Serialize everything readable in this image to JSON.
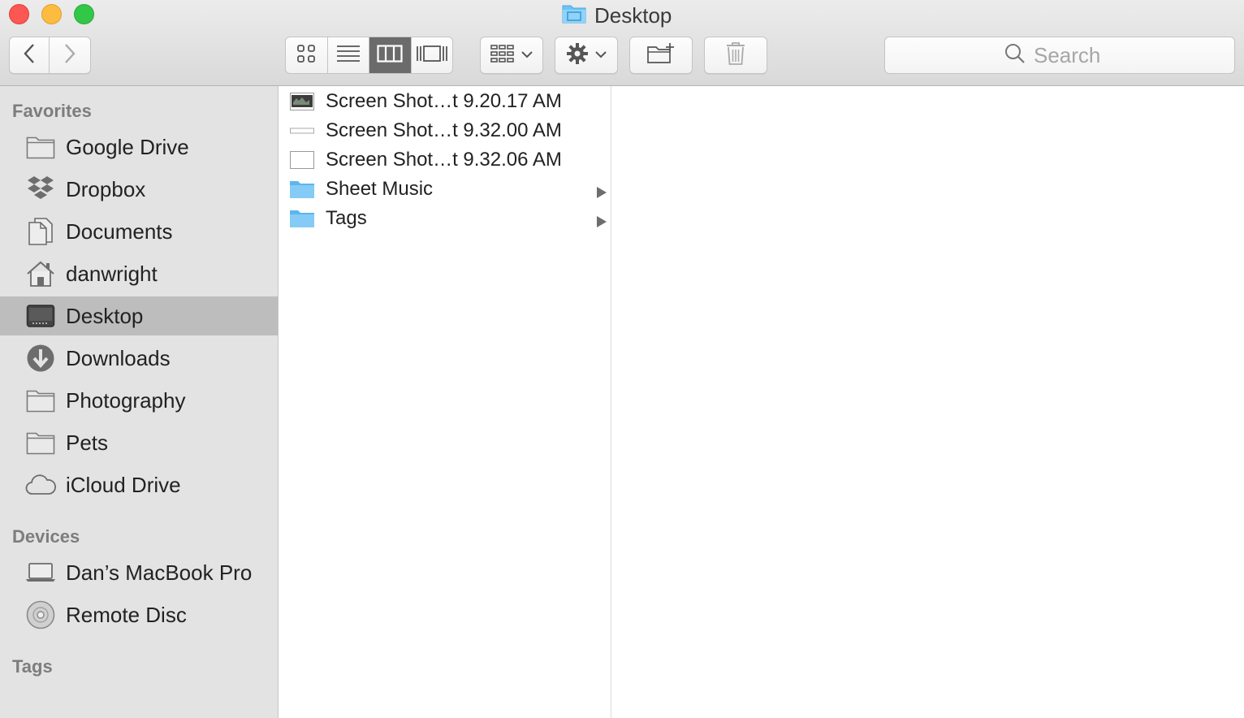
{
  "window": {
    "title": "Desktop"
  },
  "toolbar": {
    "search_placeholder": "Search",
    "view_mode_selected": "column"
  },
  "sidebar": {
    "favorites_title": "Favorites",
    "favorites": [
      {
        "label": "Google Drive",
        "icon": "folder-icon"
      },
      {
        "label": "Dropbox",
        "icon": "dropbox-icon"
      },
      {
        "label": "Documents",
        "icon": "documents-icon"
      },
      {
        "label": "danwright",
        "icon": "home-icon"
      },
      {
        "label": "Desktop",
        "icon": "desktop-icon",
        "selected": true
      },
      {
        "label": "Downloads",
        "icon": "downloads-icon"
      },
      {
        "label": "Photography",
        "icon": "folder-icon"
      },
      {
        "label": "Pets",
        "icon": "folder-icon"
      },
      {
        "label": "iCloud Drive",
        "icon": "cloud-icon"
      }
    ],
    "devices_title": "Devices",
    "devices": [
      {
        "label": "Dan’s MacBook Pro",
        "icon": "laptop-icon"
      },
      {
        "label": "Remote Disc",
        "icon": "disc-icon"
      }
    ],
    "tags_title": "Tags"
  },
  "column1": {
    "items": [
      {
        "name": "Screen Shot…t 9.20.17 AM",
        "kind": "image-thumbnail"
      },
      {
        "name": "Screen Shot…t 9.32.00 AM",
        "kind": "image-thumbnail"
      },
      {
        "name": "Screen Shot…t 9.32.06 AM",
        "kind": "image-thumbnail"
      },
      {
        "name": "Sheet Music",
        "kind": "folder"
      },
      {
        "name": "Tags",
        "kind": "folder"
      }
    ]
  },
  "colors": {
    "sidebar_bg": "#e3e3e3",
    "selected_bg": "#bdbdbd",
    "folder_blue": "#6cc3f5",
    "close": "#fc5753",
    "minimize": "#fdbc40",
    "zoom": "#33c748"
  }
}
